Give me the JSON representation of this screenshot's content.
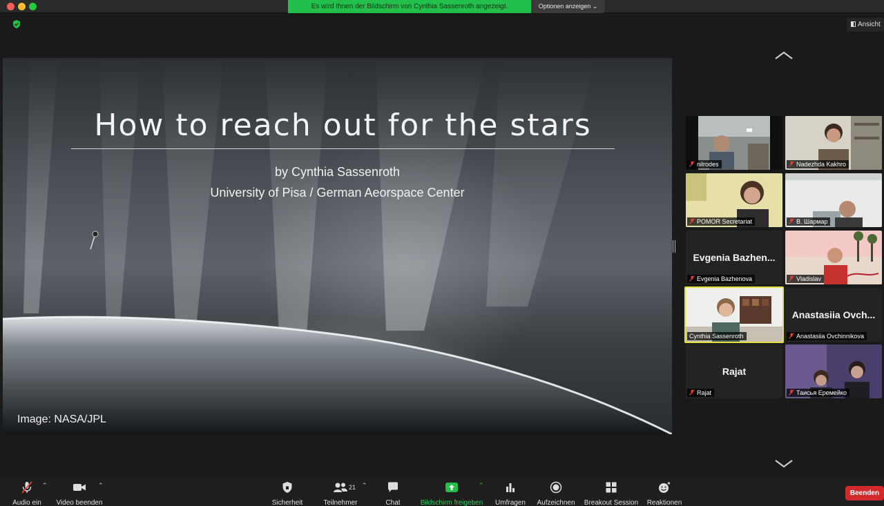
{
  "topbar": {
    "banner": "Es wird Ihnen der Bildschirm von Cynthia Sassenroth angezeigt.",
    "options_label": "Optionen anzeigen",
    "view_label": "Ansicht"
  },
  "slide": {
    "title": "How to reach out for the stars",
    "author": "by Cynthia Sassenroth",
    "affiliation": "University of Pisa / German Aeorspace Center",
    "credit": "Image: NASA/JPL"
  },
  "participants": [
    {
      "name": "nilrodes",
      "muted": true,
      "video": true
    },
    {
      "name": "Nadezhda Kakhro",
      "muted": true,
      "video": true
    },
    {
      "name": "POMOR Secretariat",
      "muted": true,
      "video": true
    },
    {
      "name": "В. Шармар",
      "muted": true,
      "video": true
    },
    {
      "name": "Evgenia Bazhenova",
      "muted": true,
      "video": false,
      "display": "Evgenia Bazhen..."
    },
    {
      "name": "Vladislav",
      "muted": true,
      "video": true
    },
    {
      "name": "Cynthia Sassenroth",
      "muted": false,
      "video": true,
      "active": true
    },
    {
      "name": "Anastasiia Ovchinnikova",
      "muted": true,
      "video": false,
      "display": "Anastasiia Ovch..."
    },
    {
      "name": "Rajat",
      "muted": true,
      "video": false,
      "display": "Rajat"
    },
    {
      "name": "Таисья Еремейко",
      "muted": true,
      "video": true
    }
  ],
  "toolbar": {
    "audio": "Audio ein",
    "video": "Video beenden",
    "security": "Sicherheit",
    "participants": "Teilnehmer",
    "participants_count": "21",
    "chat": "Chat",
    "share": "Bildschirm freigeben",
    "polls": "Umfragen",
    "record": "Aufzeichnen",
    "breakout": "Breakout Session",
    "reactions": "Reaktionen",
    "end": "Beenden"
  },
  "colors": {
    "share_green": "#22c04a",
    "end_red": "#d1292c",
    "active_speaker": "#e3e23c",
    "muted_red": "#e0453a"
  }
}
